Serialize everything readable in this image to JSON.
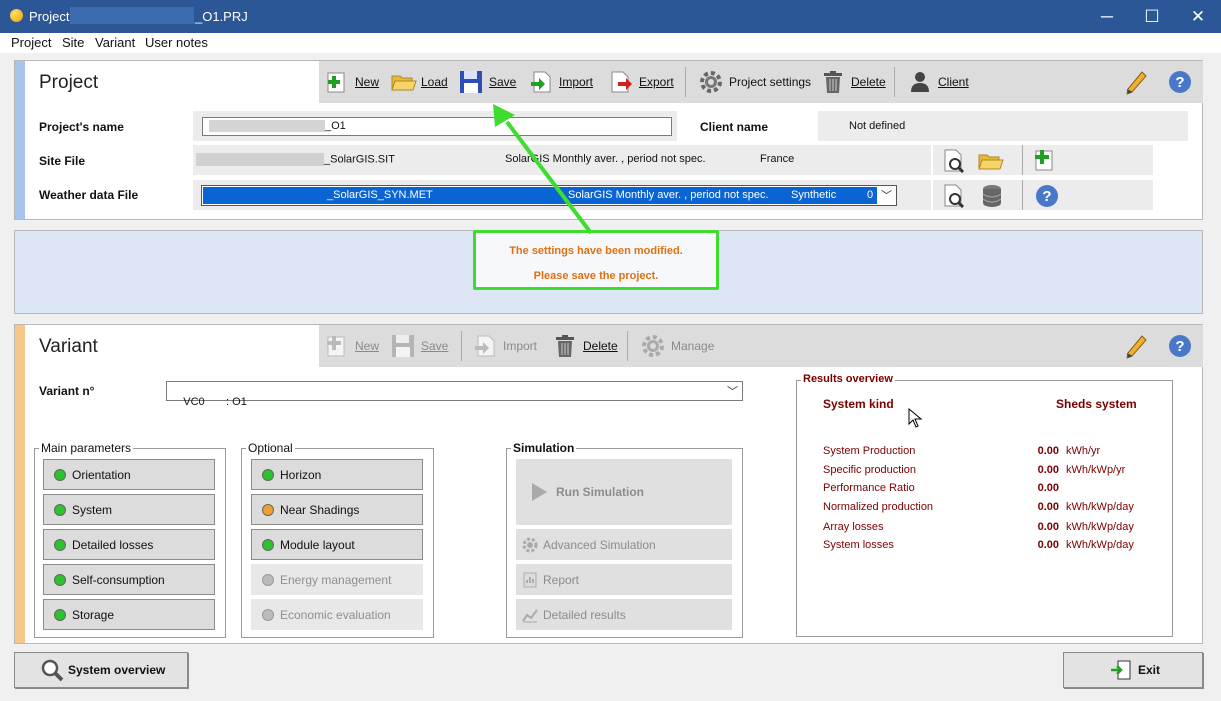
{
  "window": {
    "title_prefix": "Project:",
    "title_suffix": "_O1.PRJ",
    "minimize": "─",
    "maximize": "☐",
    "close": "✕"
  },
  "menu": [
    "Project",
    "Site",
    "Variant",
    "User notes"
  ],
  "project": {
    "title": "Project",
    "toolbar": {
      "new": "New",
      "load": "Load",
      "save": "Save",
      "import": "Import",
      "export": "Export",
      "settings": "Project settings",
      "delete": "Delete",
      "client": "Client"
    },
    "name_label": "Project's name",
    "name_value": "_O1",
    "client_label": "Client name",
    "client_value": "Not defined",
    "site_label": "Site File",
    "site_file": "_SolarGIS.SIT",
    "site_desc": "SolarGIS Monthly aver. , period not spec.",
    "site_country": "France",
    "weather_label": "Weather data File",
    "weather_file": "_SolarGIS_SYN.MET",
    "weather_desc": "SolarGIS Monthly aver. , period not spec.",
    "weather_type": "Synthetic",
    "weather_num": "0"
  },
  "message": {
    "line1": "The settings have been modified.",
    "line2": "Please save the project."
  },
  "variant": {
    "title": "Variant",
    "toolbar": {
      "new": "New",
      "save": "Save",
      "import": "Import",
      "delete": "Delete",
      "manage": "Manage"
    },
    "number_label": "Variant n°",
    "number_value": "VC0       : O1",
    "main_title": "Main parameters",
    "main": [
      "Orientation",
      "System",
      "Detailed losses",
      "Self-consumption",
      "Storage"
    ],
    "optional_title": "Optional",
    "optional": [
      "Horizon",
      "Near Shadings",
      "Module layout",
      "Energy management",
      "Economic evaluation"
    ],
    "simulation_title": "Simulation",
    "run": "Run Simulation",
    "advanced": "Advanced Simulation",
    "report": "Report",
    "detailed": "Detailed results"
  },
  "results": {
    "title": "Results overview",
    "kind_label": "System kind",
    "kind_value": "Sheds system",
    "rows": [
      {
        "label": "System Production",
        "value": "0.00",
        "unit": "kWh/yr"
      },
      {
        "label": "Specific production",
        "value": "0.00",
        "unit": "kWh/kWp/yr"
      },
      {
        "label": "Performance Ratio",
        "value": "0.00",
        "unit": ""
      },
      {
        "label": "Normalized production",
        "value": "0.00",
        "unit": "kWh/kWp/day"
      },
      {
        "label": "Array losses",
        "value": "0.00",
        "unit": "kWh/kWp/day"
      },
      {
        "label": "System losses",
        "value": "0.00",
        "unit": "kWh/kWp/day"
      }
    ]
  },
  "bottom": {
    "overview": "System overview",
    "exit": "Exit"
  },
  "colors": {
    "titlebar": "#2b5797",
    "project_stripe": "#a9c4ec",
    "variant_stripe": "#f5c78a",
    "annotation_green": "#3ddc2f",
    "warning_orange": "#e07010",
    "result_red": "#7a0000"
  }
}
